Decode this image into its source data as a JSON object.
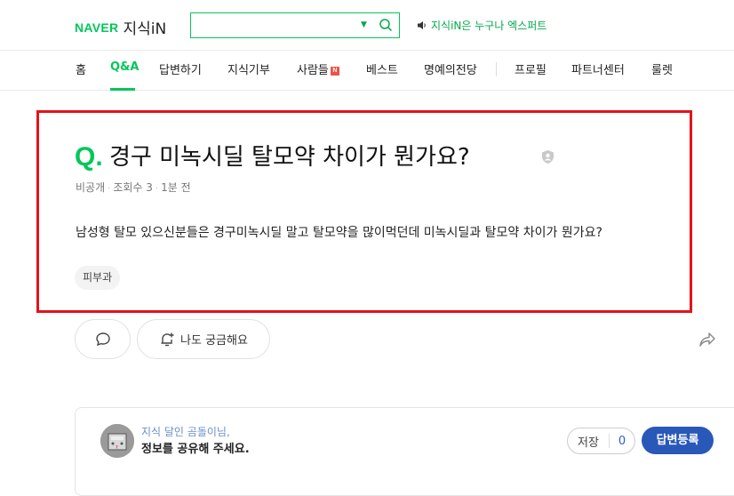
{
  "header": {
    "logo_naver": "NAVER",
    "logo_service": "지식iN",
    "search": {
      "value": "",
      "placeholder": ""
    },
    "notice": "지식iN은 누구나 엑스퍼트"
  },
  "nav": {
    "items": [
      {
        "label": "홈"
      },
      {
        "label": "Q&A"
      },
      {
        "label": "답변하기"
      },
      {
        "label": "지식기부"
      },
      {
        "label": "사람들",
        "badge": "N"
      },
      {
        "label": "베스트"
      },
      {
        "label": "명예의전당"
      },
      {
        "label": "프로필"
      },
      {
        "label": "파트너센터"
      },
      {
        "label": "룰렛"
      }
    ],
    "active_index": 1
  },
  "question": {
    "prefix": "Q.",
    "title": "경구 미녹시딜 탈모약 차이가 뭔가요?",
    "author": "비공개",
    "views": "조회수 3",
    "time": "1분 전",
    "body": "남성형 탈모 있으신분들은  경구미녹시딜 말고 탈모약을 많이먹던데 미녹시딜과 탈모약 차이가 뭔가요?",
    "tag": "피부과"
  },
  "actions": {
    "curious_label": "나도 궁금해요"
  },
  "answer_prompt": {
    "subtitle": "지식 달인 곰돌이님,",
    "message": "정보를 공유해 주세요.",
    "save_label": "저장",
    "save_count": "0",
    "submit_label": "답변등록"
  },
  "colors": {
    "brand_green": "#03c75a",
    "highlight_red": "#e3131b",
    "answer_button_blue": "#2a58b8",
    "subtitle_blue": "#6a8fc6"
  },
  "icons": {
    "search": "search-icon",
    "speaker": "speaker-icon",
    "private": "shield-icon",
    "comment": "comment-icon",
    "curious": "bell-plus-icon",
    "share": "share-icon"
  }
}
